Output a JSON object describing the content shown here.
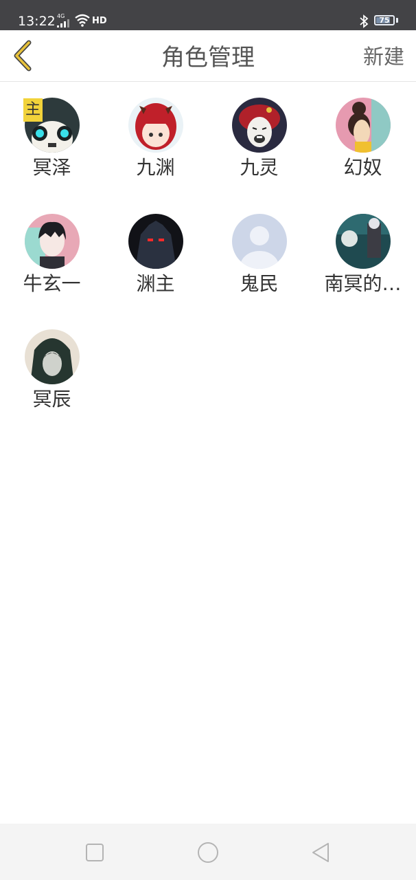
{
  "status": {
    "time": "13:22",
    "network": "4G",
    "hd": "HD",
    "battery": "75",
    "battery_level": 0.75
  },
  "nav": {
    "title": "角色管理",
    "new_label": "新建"
  },
  "roles": [
    {
      "name": "冥泽",
      "badge": "主",
      "avatar": "panda-mask-avatar"
    },
    {
      "name": "九渊",
      "avatar": "red-hair-horns-avatar"
    },
    {
      "name": "九灵",
      "avatar": "rage-face-avatar"
    },
    {
      "name": "幻奴",
      "avatar": "bun-hair-girl-avatar"
    },
    {
      "name": "牛玄一",
      "avatar": "dark-hair-boy-avatar"
    },
    {
      "name": "渊主",
      "avatar": "shadow-demon-avatar"
    },
    {
      "name": "鬼民",
      "avatar": "default-person-avatar"
    },
    {
      "name": "南冥的…",
      "avatar": "ghost-scene-avatar"
    },
    {
      "name": "冥辰",
      "avatar": "hooded-figure-avatar"
    }
  ],
  "colors": {
    "status_bar": "#434346",
    "back_arrow": "#e8c23a",
    "badge": "#f2d33a"
  }
}
